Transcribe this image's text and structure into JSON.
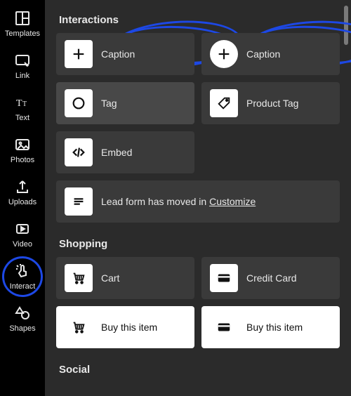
{
  "sidebar": {
    "items": [
      {
        "label": "Templates"
      },
      {
        "label": "Link"
      },
      {
        "label": "Text"
      },
      {
        "label": "Photos"
      },
      {
        "label": "Uploads"
      },
      {
        "label": "Video"
      },
      {
        "label": "Interact"
      },
      {
        "label": "Shapes"
      }
    ]
  },
  "sections": {
    "interactions_title": "Interactions",
    "shopping_title": "Shopping",
    "social_title": "Social"
  },
  "tiles": {
    "caption1": "Caption",
    "caption2": "Caption",
    "tag": "Tag",
    "product_tag": "Product Tag",
    "embed": "Embed",
    "cart": "Cart",
    "credit_card": "Credit Card",
    "buy1": "Buy this item",
    "buy2": "Buy this item"
  },
  "notice": {
    "prefix": "Lead form has moved in ",
    "link": "Customize"
  }
}
